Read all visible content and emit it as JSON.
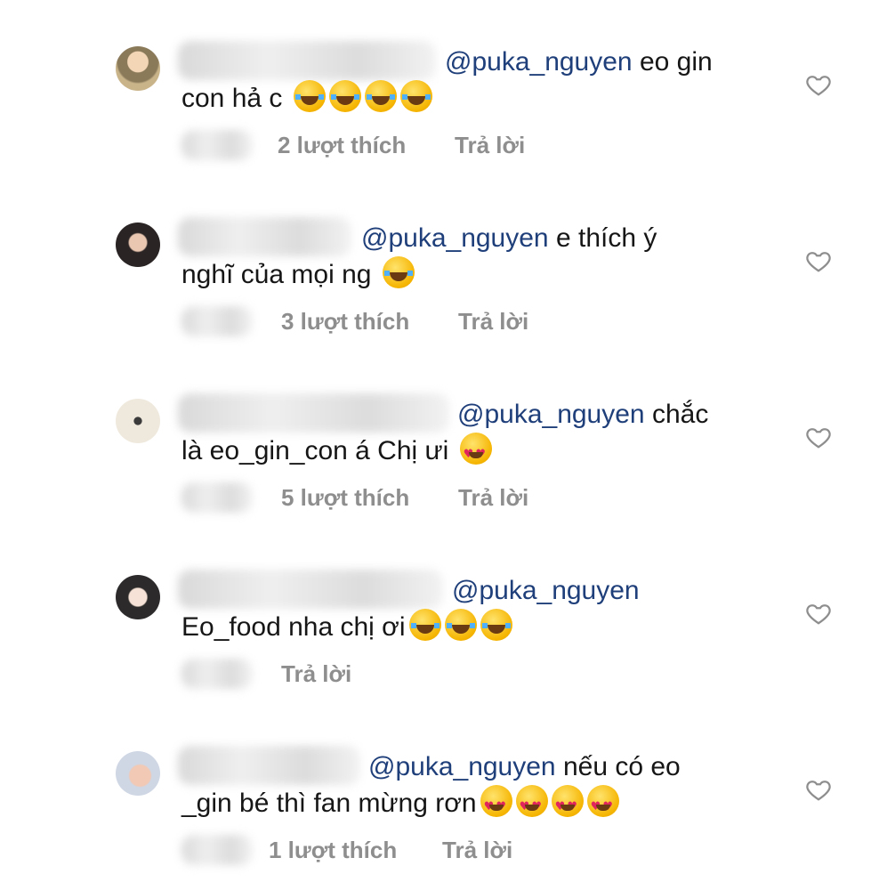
{
  "comments": [
    {
      "mention": "@puka_nguyen",
      "line1_rest": " eo gin",
      "line2": "con hả c ",
      "emojis": [
        "laugh",
        "laugh",
        "laugh",
        "laugh"
      ],
      "likes": "2 lượt thích",
      "reply": "Trả lời"
    },
    {
      "mention": "@puka_nguyen",
      "line1_rest": " e thích ý",
      "line2": "nghĩ của mọi ng ",
      "emojis": [
        "laugh"
      ],
      "likes": "3 lượt thích",
      "reply": "Trả lời"
    },
    {
      "mention": "@puka_nguyen",
      "line1_rest": " chắc",
      "line2": "là eo_gin_con á Chị ưi ",
      "emojis": [
        "love"
      ],
      "likes": "5 lượt thích",
      "reply": "Trả lời"
    },
    {
      "mention": "@puka_nguyen",
      "line1_rest": "",
      "line2": "Eo_food nha chị ơi",
      "emojis": [
        "laugh",
        "laugh",
        "laugh"
      ],
      "likes": "",
      "reply": "Trả lời"
    },
    {
      "mention": "@puka_nguyen",
      "line1_rest": " nếu có  eo",
      "line2": "_gin bé  thì  fan  mừng  rơn",
      "emojis": [
        "love",
        "love",
        "love",
        "love"
      ],
      "likes": "1 lượt thích",
      "reply": "Trả lời"
    }
  ],
  "icons": {
    "like": "heart-outline-icon",
    "emoji_laugh": "tears-of-joy-icon",
    "emoji_love": "heart-eyes-icon"
  },
  "colors": {
    "mention": "#1f3f7a",
    "meta": "#8e8e8e"
  }
}
